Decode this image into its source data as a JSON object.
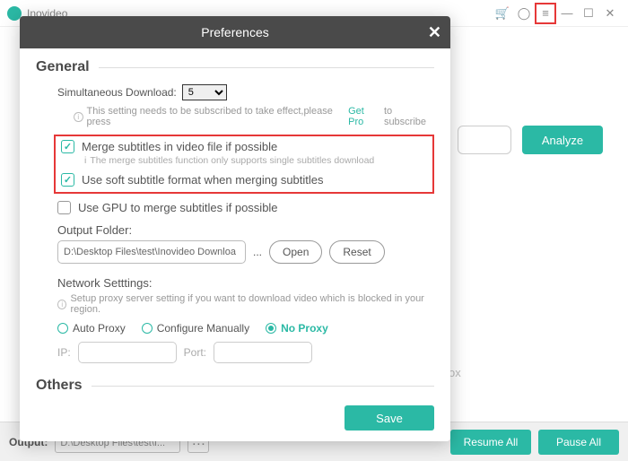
{
  "app": {
    "name": "Inovideo"
  },
  "buttons": {
    "analyze": "Analyze",
    "resume_all": "Resume All",
    "pause_all": "Pause All",
    "save": "Save",
    "open": "Open",
    "reset": "Reset"
  },
  "bottom": {
    "output_label": "Output:",
    "output_path": "D:\\Desktop Files\\test\\I..."
  },
  "ghost": "ox",
  "prefs": {
    "title": "Preferences",
    "general": "General",
    "others": "Others",
    "sim_label": "Simultaneous Download:",
    "sim_value": "5",
    "sim_note_a": "This setting needs to be subscribed to take effect,please press",
    "sim_note_link": "Get Pro",
    "sim_note_b": "to subscribe",
    "merge_sub": "Merge subtitles in video file if possible",
    "merge_sub_note": "The merge subtitles function only supports single subtitles download",
    "soft_sub": "Use soft subtitle format when merging subtitles",
    "gpu_sub": "Use GPU to merge subtitles if possible",
    "output_folder_label": "Output Folder:",
    "output_folder_value": "D:\\Desktop Files\\test\\Inovideo Downloa",
    "network_label": "Network Setttings:",
    "network_note": "Setup proxy server setting if you want to download video which is blocked in your region.",
    "proxy_auto": "Auto Proxy",
    "proxy_manual": "Configure Manually",
    "proxy_none": "No Proxy",
    "ip_label": "IP:",
    "port_label": "Port:"
  }
}
